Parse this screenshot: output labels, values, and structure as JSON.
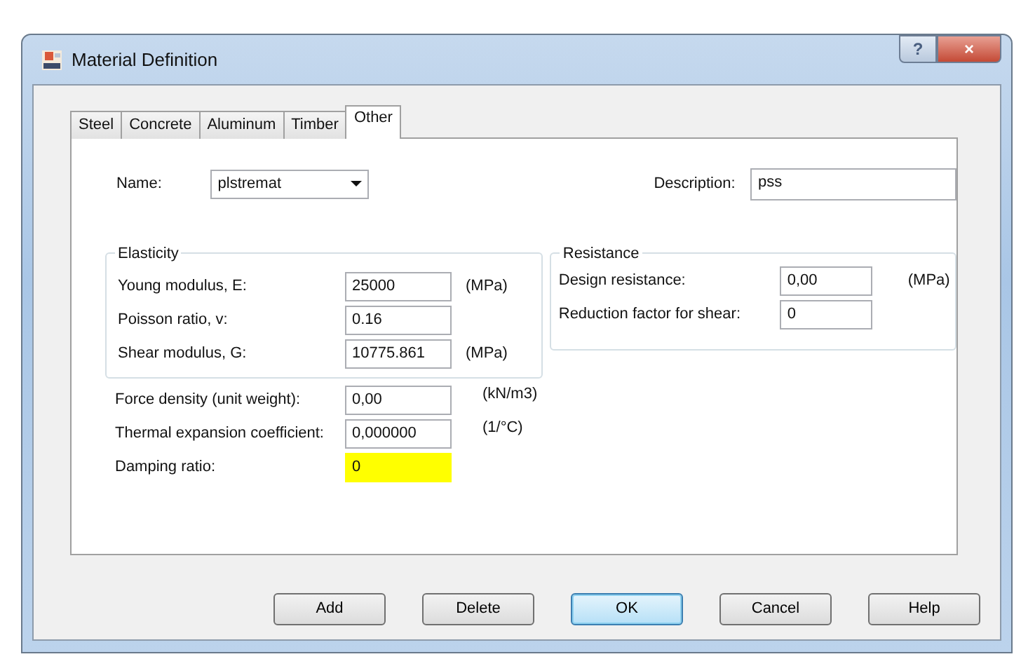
{
  "window": {
    "title": "Material Definition",
    "help_button": "?",
    "close_button": "×"
  },
  "tabs": [
    {
      "label": "Steel",
      "selected": false
    },
    {
      "label": "Concrete",
      "selected": false
    },
    {
      "label": "Aluminum",
      "selected": false
    },
    {
      "label": "Timber",
      "selected": false
    },
    {
      "label": "Other",
      "selected": true
    }
  ],
  "name": {
    "label": "Name:",
    "value": "plstremat"
  },
  "description": {
    "label": "Description:",
    "value": "pss"
  },
  "elasticity": {
    "title": "Elasticity",
    "rows": [
      {
        "label": "Young modulus, E:",
        "value": "25000",
        "unit": "(MPa)"
      },
      {
        "label": "Poisson ratio, v:",
        "value": "0.16"
      },
      {
        "label": "Shear modulus, G:",
        "value": "10775.861",
        "unit": "(MPa)"
      }
    ]
  },
  "resistance": {
    "title": "Resistance",
    "rows": [
      {
        "label": "Design resistance:",
        "value": "0,00",
        "unit": "(MPa)"
      },
      {
        "label": "Reduction factor for shear:",
        "value": "0"
      }
    ]
  },
  "properties": [
    {
      "label": "Force density (unit weight):",
      "value": "0,00",
      "unit": "(kN/m3)",
      "highlighted": false
    },
    {
      "label": "Thermal expansion coefficient:",
      "value": "0,000000",
      "unit": "(1/°C)",
      "highlighted": false
    },
    {
      "label": "Damping ratio:",
      "value": "0",
      "highlighted": true
    }
  ],
  "buttons": [
    {
      "label": "Add",
      "default": false
    },
    {
      "label": "Delete",
      "default": false
    },
    {
      "label": "OK",
      "default": true
    },
    {
      "label": "Cancel",
      "default": false
    },
    {
      "label": "Help",
      "default": false
    }
  ]
}
